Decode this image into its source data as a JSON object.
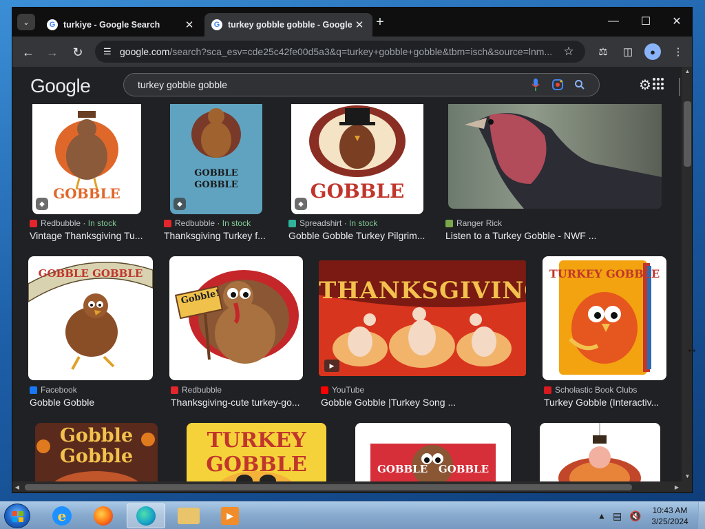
{
  "browser": {
    "tabs": [
      {
        "title": "turkiye - Google Search",
        "active": false
      },
      {
        "title": "turkey gobble gobble - Google",
        "active": true
      }
    ],
    "url_host": "google.com",
    "url_path": "/search?sca_esv=cde25c42fe00d5a3&q=turkey+gobble+gobble&tbm=isch&source=lnm..."
  },
  "google": {
    "logo": "Google",
    "query": "turkey gobble gobble"
  },
  "results": [
    {
      "source": "Redbubble",
      "stock": "In stock",
      "caption": "Vintage Thanksgiving Tu...",
      "art": "GOBBLE"
    },
    {
      "source": "Redbubble",
      "stock": "In stock",
      "caption": "Thanksgiving Turkey f...",
      "art": "GOBBLE\nGOBBLE"
    },
    {
      "source": "Spreadshirt",
      "stock": "In stock",
      "caption": "Gobble Gobble Turkey Pilgrim...",
      "art": "GOBBLE"
    },
    {
      "source": "Ranger Rick",
      "stock": "",
      "caption": "Listen to a Turkey Gobble - NWF ...",
      "art": ""
    },
    {
      "source": "Facebook",
      "stock": "",
      "caption": "Gobble Gobble",
      "art": "GOBBLE GOBBLE"
    },
    {
      "source": "Redbubble",
      "stock": "",
      "caption": "Thanksgiving-cute turkey-go...",
      "art": "Gobble!"
    },
    {
      "source": "YouTube",
      "stock": "",
      "caption": "Gobble Gobble |Turkey Song ...",
      "art": "THANKSGIVING"
    },
    {
      "source": "Scholastic Book Clubs",
      "stock": "",
      "caption": "Turkey Gobble (Interactiv...",
      "art": "TURKEY GOBBLE"
    },
    {
      "source": "",
      "stock": "",
      "caption": "",
      "art": "Gobble\nGobble"
    },
    {
      "source": "",
      "stock": "",
      "caption": "",
      "art": "TURKEY GOBBLE"
    },
    {
      "source": "",
      "stock": "",
      "caption": "",
      "art": "GOBBLE   GOBBLE"
    },
    {
      "source": "",
      "stock": "",
      "caption": "",
      "art": ""
    }
  ],
  "taskbar": {
    "time": "10:43 AM",
    "date": "3/25/2024"
  },
  "colors": {
    "page_bg": "#202124",
    "in_stock": "#81c995",
    "redbubble": "#e4252c",
    "youtube": "#ff0000"
  }
}
